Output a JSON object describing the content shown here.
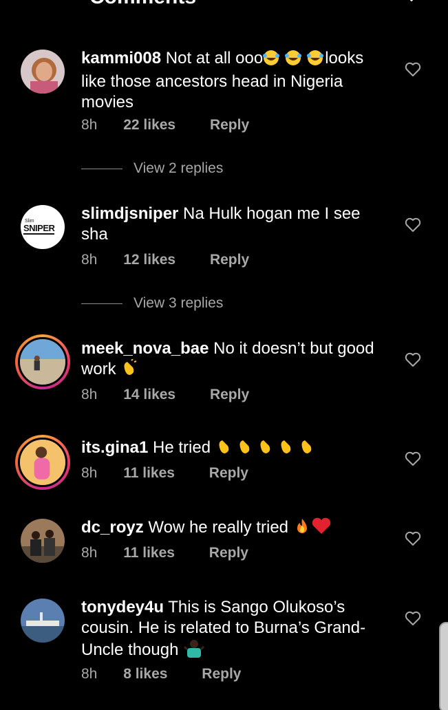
{
  "header": {
    "title": "Comments"
  },
  "comments": [
    {
      "username": "kammi008",
      "text_before": "Not at all ooo",
      "emoji_laugh_count": 3,
      "text_after": "looks like those ancestors head in Nigeria movies",
      "time": "8h",
      "likes": "22 likes",
      "reply": "Reply",
      "view_replies": "View 2 replies",
      "has_story_ring": false
    },
    {
      "username": "slimdjsniper",
      "text": "Na Hulk hogan me I see sha",
      "time": "8h",
      "likes": "12 likes",
      "reply": "Reply",
      "view_replies": "View 3 replies",
      "avatar_logo_small": "Slim",
      "avatar_logo": "SNIPER",
      "has_story_ring": false
    },
    {
      "username": "meek_nova_bae",
      "text": "No it doesn’t but good work",
      "emoji": "clap",
      "time": "8h",
      "likes": "14 likes",
      "reply": "Reply",
      "has_story_ring": true
    },
    {
      "username": "its.gina1",
      "text": "He tried",
      "emoji": "clap x5",
      "time": "8h",
      "likes": "11 likes",
      "reply": "Reply",
      "has_story_ring": true
    },
    {
      "username": "dc_royz",
      "text": "Wow he really tried",
      "emoji": "fire, heart",
      "time": "8h",
      "likes": "11 likes",
      "reply": "Reply",
      "has_story_ring": false
    },
    {
      "username": "tonydey4u",
      "text": "This is Sango Olukoso’s cousin. He is related to Burna’s Grand-Uncle though",
      "emoji": "shrug",
      "time": "8h",
      "likes": "8 likes",
      "reply": "Reply",
      "has_story_ring": false
    }
  ],
  "colors": {
    "background": "#000000",
    "text": "#ffffff",
    "secondary": "#a8a8a8"
  }
}
